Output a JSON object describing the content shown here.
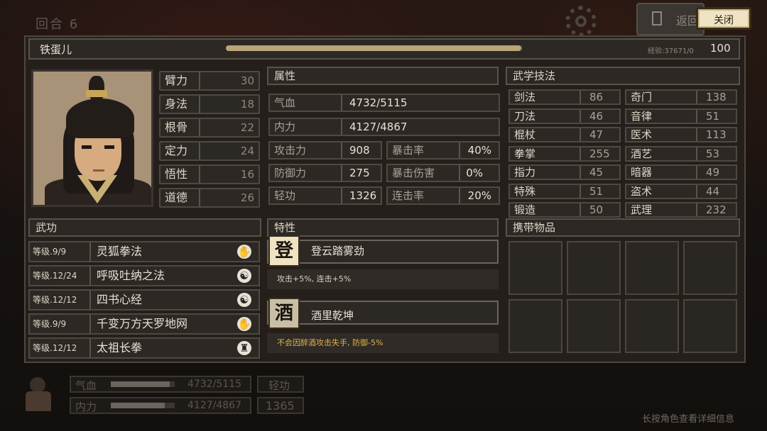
{
  "top": {
    "round_label": "回合 6",
    "back_label": "返回",
    "close_label": "关闭"
  },
  "character": {
    "name": "铁蛋儿",
    "exp_text": "经验:37671/0",
    "exp_progress": 1.0,
    "level": "100"
  },
  "base_stats": [
    {
      "label": "臂力",
      "value": "30"
    },
    {
      "label": "身法",
      "value": "18"
    },
    {
      "label": "根骨",
      "value": "22"
    },
    {
      "label": "定力",
      "value": "24"
    },
    {
      "label": "悟性",
      "value": "16"
    },
    {
      "label": "道德",
      "value": "26"
    }
  ],
  "attributes": {
    "title": "属性",
    "hp": {
      "label": "气血",
      "value": "4732/5115"
    },
    "mp": {
      "label": "内力",
      "value": "4127/4867"
    },
    "atk": {
      "label": "攻击力",
      "value": "908"
    },
    "crit_rate": {
      "label": "暴击率",
      "value": "40%"
    },
    "def": {
      "label": "防御力",
      "value": "275"
    },
    "crit_dmg": {
      "label": "暴击伤害",
      "value": "0%"
    },
    "qinggong": {
      "label": "轻功",
      "value": "1326"
    },
    "combo": {
      "label": "连击率",
      "value": "20%"
    }
  },
  "martial_arts": {
    "title": "武功",
    "items": [
      {
        "level": "等级.9/9",
        "name": "灵狐拳法",
        "icon": "fist-icon",
        "glyph": "✋"
      },
      {
        "level": "等级.12/24",
        "name": "呼吸吐纳之法",
        "icon": "yinyang-icon",
        "glyph": "☯"
      },
      {
        "level": "等级.12/12",
        "name": "四书心经",
        "icon": "yinyang-icon",
        "glyph": "☯"
      },
      {
        "level": "等级.9/9",
        "name": "千变万方天罗地网",
        "icon": "fist-icon",
        "glyph": "✋"
      },
      {
        "level": "等级.12/12",
        "name": "太祖长拳",
        "icon": "gourd-icon",
        "glyph": "♜"
      }
    ]
  },
  "traits": {
    "title": "特性",
    "items": [
      {
        "icon_char": "登",
        "name": "登云踏雾劲",
        "desc": "攻击+5%, 连击+5%",
        "desc_color": "#d8d0c2"
      },
      {
        "icon_char": "酒",
        "name": "酒里乾坤",
        "desc": "不会因醉酒攻击失手, 防御-5%",
        "desc_color": "#e0b24a"
      }
    ]
  },
  "skills": {
    "title": "武学技法",
    "left": [
      {
        "label": "剑法",
        "value": "86"
      },
      {
        "label": "刀法",
        "value": "46"
      },
      {
        "label": "棍杖",
        "value": "47"
      },
      {
        "label": "拳掌",
        "value": "255"
      },
      {
        "label": "指力",
        "value": "45"
      },
      {
        "label": "特殊",
        "value": "51"
      },
      {
        "label": "锻造",
        "value": "50"
      }
    ],
    "right": [
      {
        "label": "奇门",
        "value": "138"
      },
      {
        "label": "音律",
        "value": "51"
      },
      {
        "label": "医术",
        "value": "113"
      },
      {
        "label": "酒艺",
        "value": "53"
      },
      {
        "label": "暗器",
        "value": "49"
      },
      {
        "label": "盗术",
        "value": "44"
      },
      {
        "label": "武理",
        "value": "232"
      }
    ]
  },
  "inventory": {
    "title": "携带物品",
    "slots": 8
  },
  "hud": {
    "hp_label": "气血",
    "hp_value": "4732/5115",
    "hp_progress": 0.925,
    "mp_label": "内力",
    "mp_value": "4127/4867",
    "mp_progress": 0.848,
    "qinggong_label": "轻功",
    "qinggong_value": "1365",
    "hint": "长按角色查看详细信息"
  }
}
